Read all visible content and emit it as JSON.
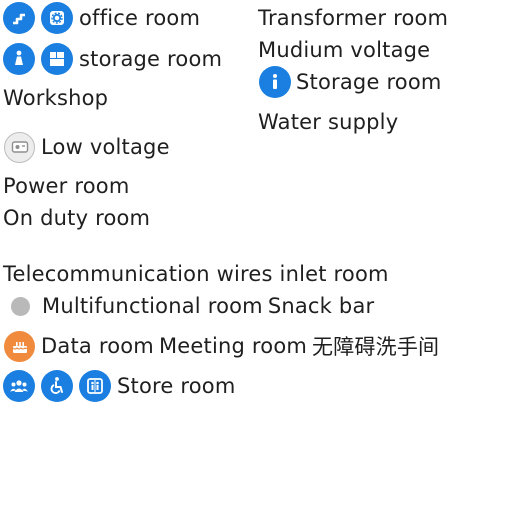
{
  "labels": {
    "office_room": "office room",
    "transformer_room": "Transformer room",
    "storage_room_lower": "storage room",
    "mudium_voltage": "Mudium voltage",
    "workshop": "Workshop",
    "storage_room_upper": "Storage room",
    "water_supply": "Water supply",
    "low_voltage": "Low voltage",
    "power_room": "Power room",
    "on_duty_room": "On duty room",
    "telecom_room": "Telecommunication wires inlet room",
    "multifunctional_room": "Multifunctional room",
    "snack_bar": "Snack bar",
    "data_room": "Data room",
    "meeting_room": "Meeting room",
    "accessible_restroom": "无障碍洗手间",
    "store_room": "Store room"
  },
  "icons": {
    "stairs": "stairs-icon",
    "settings": "gear-icon",
    "person": "person-icon",
    "grid": "grid-icon",
    "info": "info-icon",
    "power": "power-socket-icon",
    "cake": "cake-icon",
    "group": "group-icon",
    "wheelchair": "wheelchair-icon",
    "elevator": "elevator-icon"
  },
  "colors": {
    "icon_blue": "#1a7fe0",
    "icon_orange": "#f08a3c",
    "dot_gray": "#b9b9b9"
  }
}
